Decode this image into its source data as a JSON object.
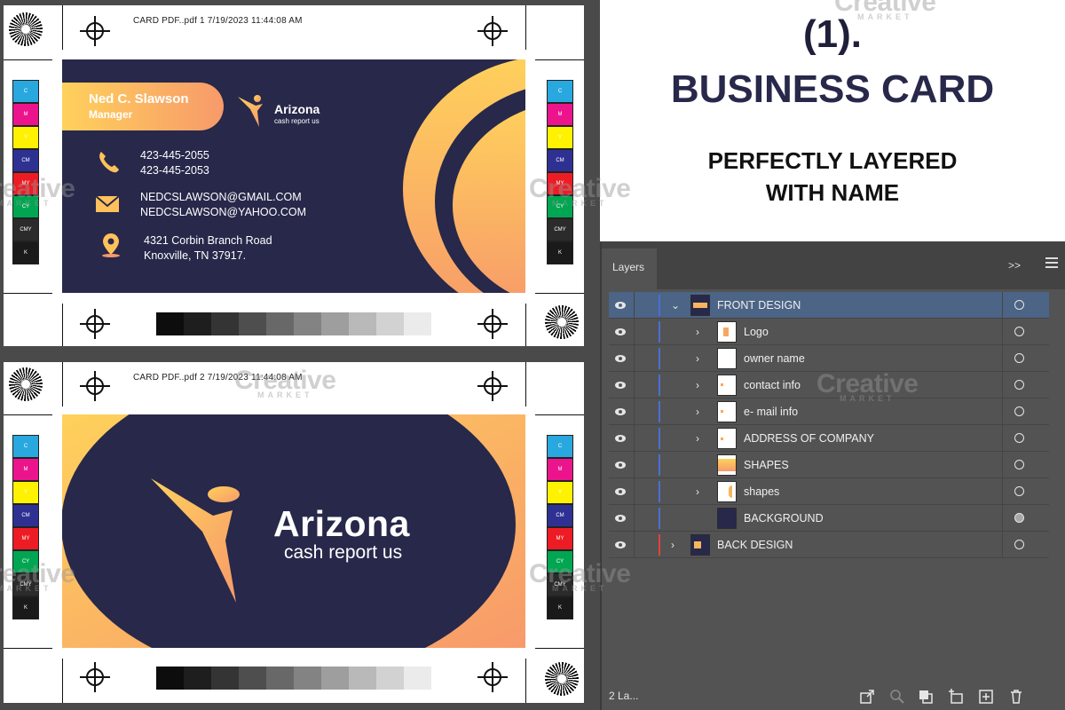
{
  "front_sheet": {
    "slug": "CARD PDF..pdf  1  7/19/2023  11:44:08 AM",
    "color_patches": [
      {
        "label": "C",
        "color": "#29a8e0"
      },
      {
        "label": "M",
        "color": "#ec148c"
      },
      {
        "label": "Y",
        "color": "#fff200"
      },
      {
        "label": "CM",
        "color": "#2e3192"
      },
      {
        "label": "MY",
        "color": "#ed1c24"
      },
      {
        "label": "CY",
        "color": "#00a651"
      },
      {
        "label": "CMY",
        "color": "#2b2b2b"
      },
      {
        "label": "K",
        "color": "#1a1a1a"
      }
    ],
    "gray_steps": [
      "#0d0d0d",
      "#1e1e1e",
      "#343434",
      "#4e4e4e",
      "#686868",
      "#838383",
      "#9e9e9e",
      "#b9b9b9",
      "#d2d2d2",
      "#ebebeb"
    ],
    "card": {
      "name": "Ned C. Slawson",
      "role": "Manager",
      "brand": "Arizona",
      "brand_sub": "cash report us",
      "phone_1": "423-445-2055",
      "phone_2": "423-445-2053",
      "email_1": "NEDCSLAWSON@GMAIL.COM",
      "email_2": "NEDCSLAWSON@YAHOO.COM",
      "address_1": "4321 Corbin Branch Road",
      "address_2": "Knoxville, TN 37917.",
      "colors": {
        "navy": "#27284a",
        "gradient_start": "#ffd15c",
        "gradient_end": "#f79a6a"
      }
    }
  },
  "back_sheet": {
    "slug": "CARD PDF..pdf  2  7/19/2023  11:44:08 AM",
    "card": {
      "brand": "Arizona",
      "brand_sub": "cash report us"
    }
  },
  "title_panel": {
    "number": "(1).",
    "title": "BUSINESS CARD",
    "line_1": "PERFECTLY LAYERED",
    "line_2": "WITH NAME"
  },
  "layers_panel": {
    "tab": "Layers",
    "collapse_label": ">>",
    "layers": [
      {
        "name": "FRONT DESIGN",
        "level": 0,
        "twirl": "open",
        "selected": true,
        "color": "blue"
      },
      {
        "name": "Logo",
        "level": 1,
        "twirl": "closed",
        "selected": false,
        "color": "blue"
      },
      {
        "name": "owner name",
        "level": 1,
        "twirl": "closed",
        "selected": false,
        "color": "blue"
      },
      {
        "name": "contact info",
        "level": 1,
        "twirl": "closed",
        "selected": false,
        "color": "blue"
      },
      {
        "name": "e- mail info",
        "level": 1,
        "twirl": "closed",
        "selected": false,
        "color": "blue"
      },
      {
        "name": "ADDRESS OF COMPANY",
        "level": 1,
        "twirl": "closed",
        "selected": false,
        "color": "blue"
      },
      {
        "name": "SHAPES",
        "level": 1,
        "twirl": "none",
        "selected": false,
        "color": "blue"
      },
      {
        "name": "shapes",
        "level": 1,
        "twirl": "closed",
        "selected": false,
        "color": "blue"
      },
      {
        "name": "BACKGROUND",
        "level": 1,
        "twirl": "none",
        "selected": false,
        "color": "blue"
      },
      {
        "name": "BACK DESIGN",
        "level": 0,
        "twirl": "closed",
        "selected": false,
        "color": "red"
      }
    ],
    "layer_count": "2 La...",
    "footer_icons": [
      "export-icon",
      "locate-object-icon",
      "clipping-mask-icon",
      "new-sublayer-icon",
      "new-layer-icon",
      "delete-icon"
    ]
  },
  "watermark": {
    "text": "Creative",
    "sub": "MARKET"
  }
}
